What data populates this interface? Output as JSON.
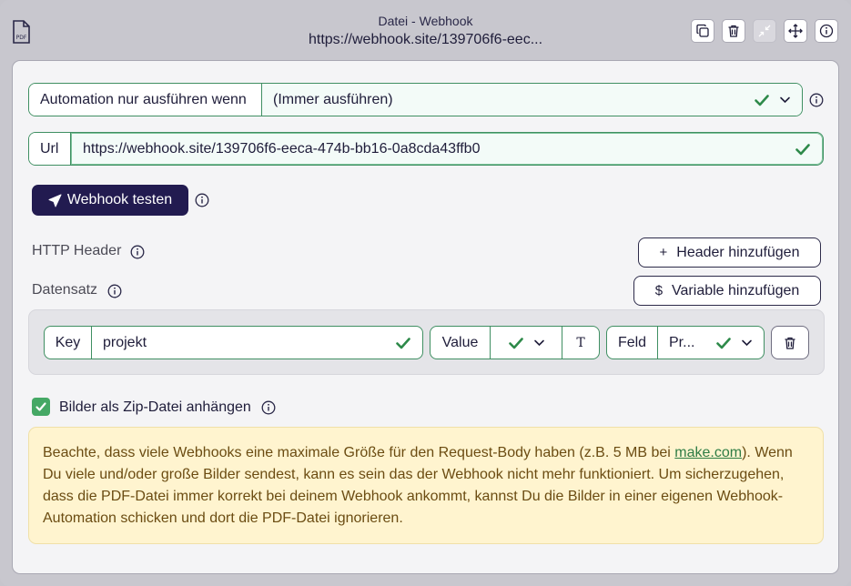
{
  "header": {
    "file_icon_label": "PDF",
    "title": "Datei - Webhook",
    "url": "https://webhook.site/139706f6-eec..."
  },
  "automation": {
    "label": "Automation nur ausführen wenn",
    "value": "(Immer ausführen)"
  },
  "url_field": {
    "label": "Url",
    "value": "https://webhook.site/139706f6-eeca-474b-bb16-0a8cda43ffb0"
  },
  "test_button": {
    "label": "Webhook testen"
  },
  "http_header": {
    "label": "HTTP Header",
    "add_button": "Header hinzufügen",
    "add_symbol": "+"
  },
  "datensatz": {
    "label": "Datensatz",
    "add_button": "Variable hinzufügen",
    "add_symbol": "$"
  },
  "row": {
    "key_label": "Key",
    "key_value": "projekt",
    "value_label": "Value",
    "text_toggle": "T",
    "field_label": "Feld",
    "field_value": "Pr..."
  },
  "zip": {
    "checked": true,
    "label": "Bilder als Zip-Datei anhängen"
  },
  "notice": {
    "text_before": "Beachte, dass viele Webhooks eine maximale Größe für den Request-Body haben (z.B. 5 MB bei ",
    "link": "make.com",
    "text_after": "). Wenn Du viele und/oder große Bilder sendest, kann es sein das der Webhook nicht mehr funktioniert. Um sicherzugehen, dass die PDF-Datei immer korrekt bei deinem Webhook ankommt, kannst Du die Bilder in einer eigenen Webhook-Automation schicken und dort die PDF-Datei ignorieren."
  },
  "colors": {
    "accent": "#221b50",
    "success": "#3f8f62",
    "notice_bg": "#fff4cf",
    "notice_text": "#6b4c12"
  }
}
